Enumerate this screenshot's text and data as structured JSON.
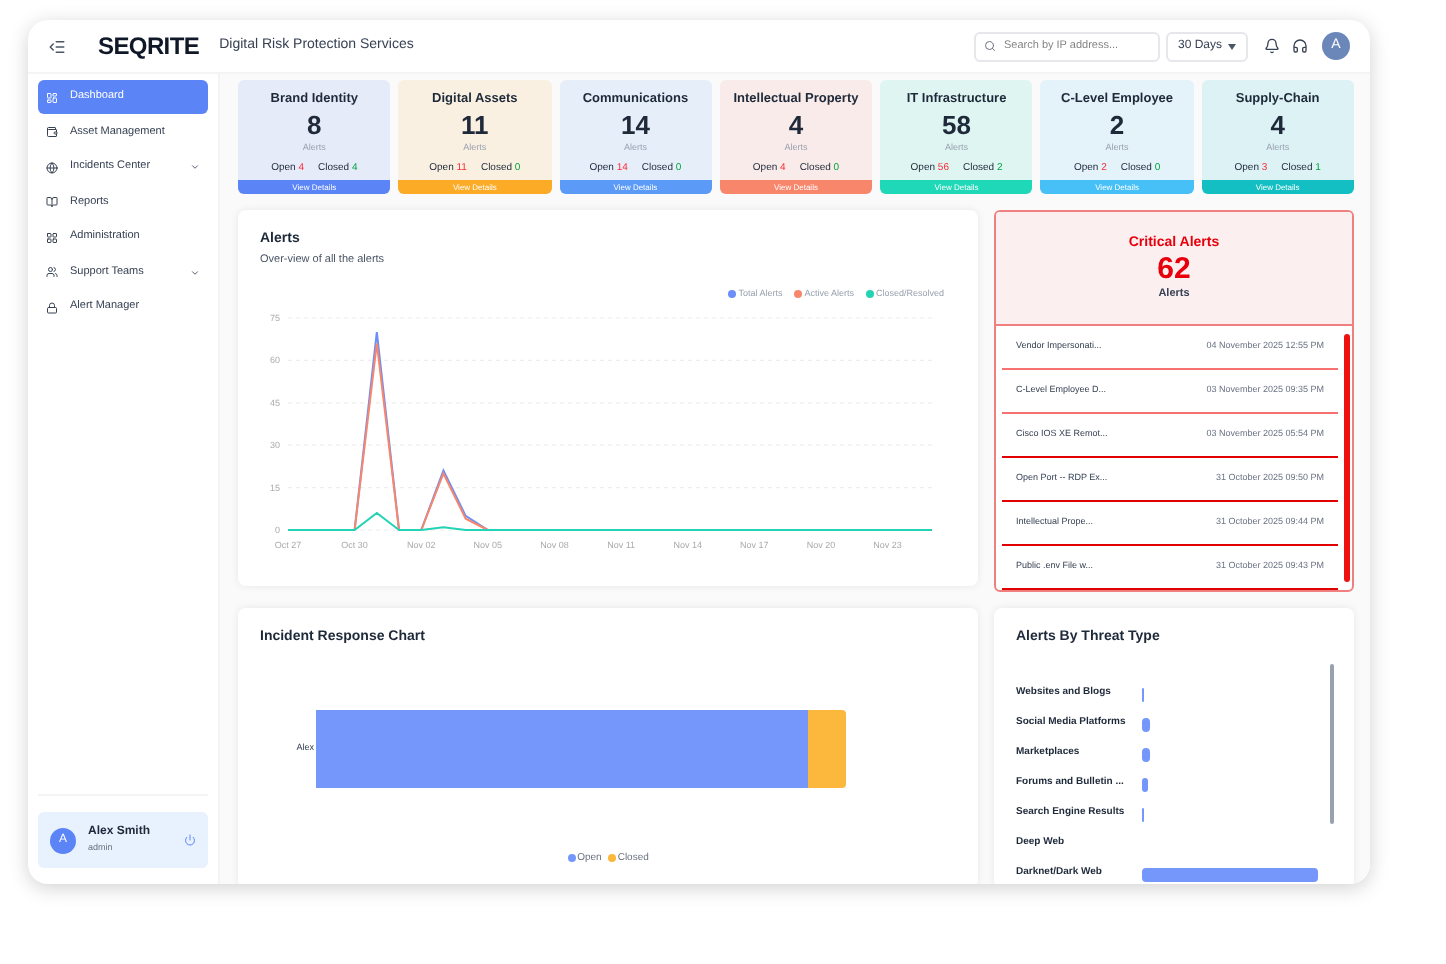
{
  "header": {
    "logo": "SEQRITE",
    "title": "Digital Risk Protection Services",
    "search": {
      "placeholder": "Search by IP address..."
    },
    "range": "30 Days",
    "avatar": "A"
  },
  "sidebar": {
    "items": [
      {
        "label": "Dashboard",
        "selected": true,
        "kind": "link"
      },
      {
        "label": "Asset Management",
        "selected": false,
        "kind": "link"
      },
      {
        "label": "Incidents Center",
        "selected": false,
        "kind": "group"
      },
      {
        "label": "Reports",
        "selected": false,
        "kind": "link"
      },
      {
        "label": "Administration",
        "selected": false,
        "kind": "link"
      },
      {
        "label": "Support Teams",
        "selected": false,
        "kind": "group"
      },
      {
        "label": "Alert Manager",
        "selected": false,
        "kind": "link"
      }
    ],
    "user": {
      "initial": "A",
      "name": "Alex Smith",
      "role": "admin"
    }
  },
  "cards": [
    {
      "title": "Brand Identity",
      "count": "8",
      "unit": "Alerts",
      "open_label": "Open",
      "open": "4",
      "closed_label": "Closed",
      "closed": "4",
      "button": "View Details",
      "color": "#5b84f7"
    },
    {
      "title": "Digital Assets",
      "count": "11",
      "unit": "Alerts",
      "open_label": "Open",
      "open": "11",
      "closed_label": "Closed",
      "closed": "0",
      "button": "View Details",
      "color": "#fbab26"
    },
    {
      "title": "Communications",
      "count": "14",
      "unit": "Alerts",
      "open_label": "Open",
      "open": "14",
      "closed_label": "Closed",
      "closed": "0",
      "button": "View Details",
      "color": "#5b9af7"
    },
    {
      "title": "Intellectual Property",
      "count": "4",
      "unit": "Alerts",
      "open_label": "Open",
      "open": "4",
      "closed_label": "Closed",
      "closed": "0",
      "button": "View Details",
      "color": "#f7866b"
    },
    {
      "title": "IT Infrastructure",
      "count": "58",
      "unit": "Alerts",
      "open_label": "Open",
      "open": "56",
      "closed_label": "Closed",
      "closed": "2",
      "button": "View Details",
      "color": "#1fd8b8"
    },
    {
      "title": "C-Level Employee",
      "count": "2",
      "unit": "Alerts",
      "open_label": "Open",
      "open": "2",
      "closed_label": "Closed",
      "closed": "0",
      "button": "View Details",
      "color": "#47bff7"
    },
    {
      "title": "Supply-Chain",
      "count": "4",
      "unit": "Alerts",
      "open_label": "Open",
      "open": "3",
      "closed_label": "Closed",
      "closed": "1",
      "button": "View Details",
      "color": "#13bfc2"
    }
  ],
  "alerts": {
    "title": "Alerts",
    "subtitle": "Over-view of all the alerts",
    "chart_data": {
      "type": "line",
      "categories": [
        "Oct 27",
        null,
        null,
        "Oct 30",
        null,
        null,
        "Nov 02",
        null,
        null,
        "Nov 05",
        null,
        null,
        "Nov 08",
        null,
        null,
        "Nov 11",
        null,
        null,
        "Nov 14",
        null,
        null,
        "Nov 17",
        null,
        null,
        "Nov 20",
        null,
        null,
        "Nov 23",
        null,
        null
      ],
      "series": [
        {
          "name": "Total Alerts",
          "color": "#6b8ef7",
          "values": [
            null,
            null,
            null,
            0,
            70,
            0,
            0,
            21,
            5,
            0,
            null,
            null,
            null,
            null,
            null,
            null,
            null,
            null,
            null,
            null,
            null,
            null,
            null,
            null,
            null,
            null,
            null,
            null,
            null,
            null
          ]
        },
        {
          "name": "Active Alerts",
          "color": "#f7866b",
          "values": [
            null,
            null,
            null,
            0,
            66,
            0,
            0,
            20,
            4,
            0,
            null,
            null,
            null,
            null,
            null,
            null,
            null,
            null,
            null,
            null,
            null,
            null,
            null,
            null,
            null,
            null,
            null,
            null,
            null,
            null
          ]
        },
        {
          "name": "Closed/Resolved",
          "color": "#22d3b5",
          "values": [
            0,
            0,
            0,
            0,
            6,
            0,
            0,
            1,
            0,
            0,
            0,
            0,
            0,
            0,
            0,
            0,
            0,
            0,
            0,
            0,
            0,
            0,
            0,
            0,
            0,
            0,
            0,
            0,
            0,
            0
          ]
        }
      ],
      "grid": true,
      "ylim": [
        0,
        75
      ],
      "yticks": [
        0,
        15,
        30,
        45,
        60,
        75
      ]
    }
  },
  "critical": {
    "title": "Critical Alerts",
    "count": "62",
    "unit": "Alerts",
    "items": [
      {
        "name": "Vendor Impersonati...",
        "date": "04 November 2025 12:55 PM",
        "color": "#f87171"
      },
      {
        "name": "C-Level Employee D...",
        "date": "03 November 2025 09:35 PM",
        "color": "#f87171"
      },
      {
        "name": "Cisco IOS XE Remot...",
        "date": "03 November 2025 05:54 PM",
        "color": "#e00000"
      },
      {
        "name": "Open Port -- RDP Ex...",
        "date": "31 October 2025 09:50 PM",
        "color": "#e00000"
      },
      {
        "name": "Intellectual Prope...",
        "date": "31 October 2025 09:44 PM",
        "color": "#e00000"
      },
      {
        "name": "Public .env File w...",
        "date": "31 October 2025 09:43 PM",
        "color": "#e00000"
      }
    ]
  },
  "incident": {
    "title": "Incident Response Chart",
    "category": "Alex",
    "legend": [
      {
        "name": "Open",
        "color": "#7597fc"
      },
      {
        "name": "Closed",
        "color": "#fcb73d"
      }
    ]
  },
  "threats": {
    "title": "Alerts By Threat Type",
    "items": [
      {
        "label": "Websites and Blogs"
      },
      {
        "label": "Social Media Platforms"
      },
      {
        "label": "Marketplaces"
      },
      {
        "label": "Forums and Bulletin ..."
      },
      {
        "label": "Search Engine Results"
      },
      {
        "label": "Deep Web"
      },
      {
        "label": "Darknet/Dark Web"
      }
    ]
  }
}
